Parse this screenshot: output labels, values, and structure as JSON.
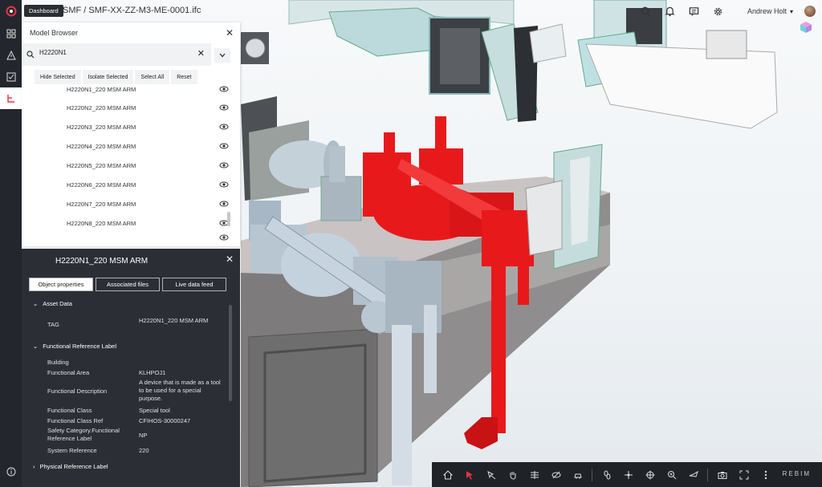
{
  "breadcrumb": "SMF / SMF-XX-ZZ-M3-ME-0001.ifc",
  "tooltip": "Dashboard",
  "user": {
    "name": "Andrew Holt"
  },
  "model_browser": {
    "title": "Model Browser",
    "search_value": "H2220N1",
    "actions": [
      "Hide Selected",
      "Isolate Selected",
      "Select All",
      "Reset"
    ],
    "items": [
      "H2220N1_220 MSM ARM",
      "H2220N2_220 MSM ARM",
      "H2220N3_220 MSM ARM",
      "H2220N4_220 MSM ARM",
      "H2220N5_220 MSM ARM",
      "H2220N6_220 MSM ARM",
      "H2220N7_220 MSM ARM",
      "H2220N8_220 MSM ARM"
    ]
  },
  "properties": {
    "title": "H2220N1_220 MSM ARM",
    "tabs": [
      "Object properties",
      "Associated files",
      "Live data feed"
    ],
    "sections": {
      "asset": "Asset Data",
      "functional": "Functional Reference Label",
      "physical": "Physical Reference Label"
    },
    "asset_rows": [
      {
        "label": "TAG",
        "value": "H2220N1_220 MSM ARM"
      }
    ],
    "functional_rows": [
      {
        "label": "Building",
        "value": ""
      },
      {
        "label": "Functional Area",
        "value": "KLHPOJ1"
      },
      {
        "label": "Functional Description",
        "value": "A device that is made as a tool to be used for a special purpose."
      },
      {
        "label": "Functional Class",
        "value": "Special tool"
      },
      {
        "label": "Functional Class Ref",
        "value": "CFIHOS-30000247"
      },
      {
        "label": "Safety Category.Functional Reference Label",
        "value": "NP"
      },
      {
        "label": "System Reference",
        "value": "220"
      }
    ]
  },
  "toolbar_brand": "REBIM",
  "colors": {
    "rail": "#23272d",
    "panel_dark": "#2b2f35",
    "highlight": "#e8191b",
    "accent": "#e6304a"
  }
}
